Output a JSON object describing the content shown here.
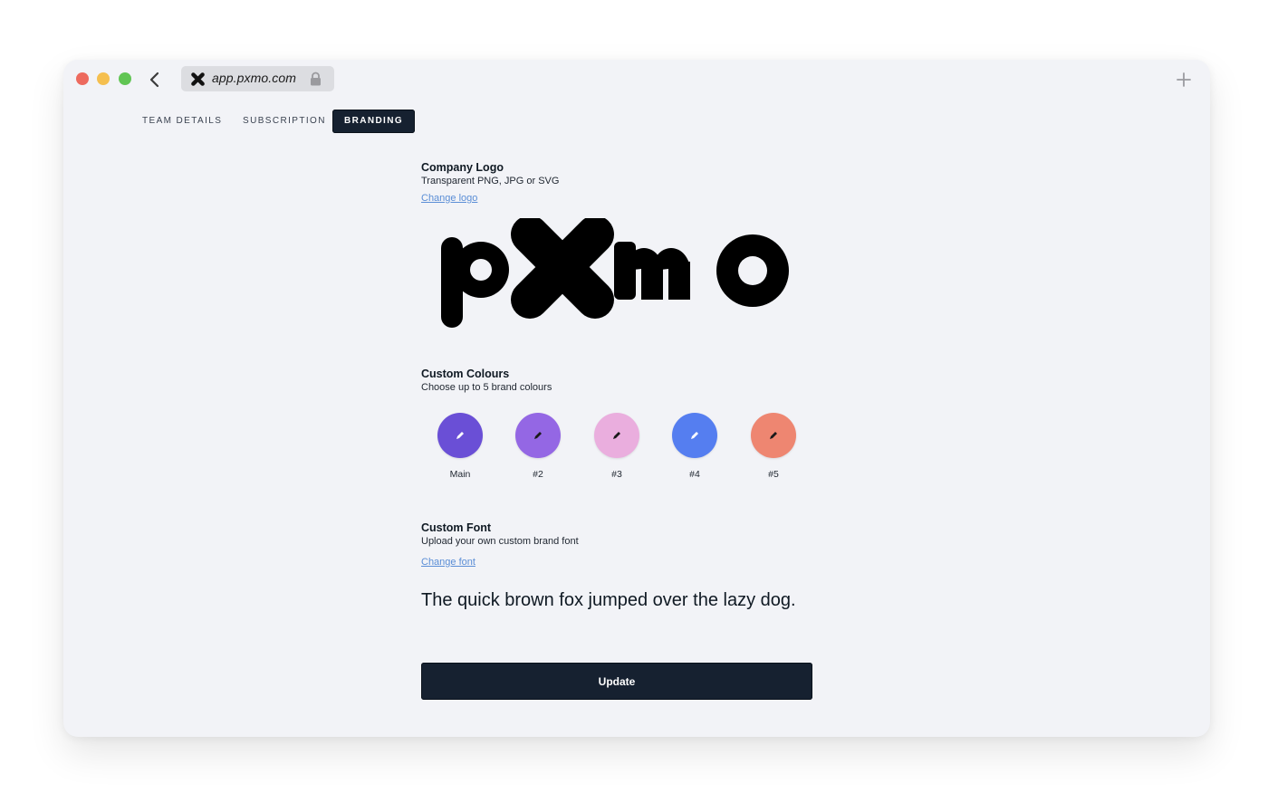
{
  "browser": {
    "url": "app.pxmo.com"
  },
  "tabs": [
    {
      "label": "TEAM DETAILS",
      "active": false
    },
    {
      "label": "SUBSCRIPTION",
      "active": false
    },
    {
      "label": "BRANDING",
      "active": true
    }
  ],
  "logo_section": {
    "title": "Company Logo",
    "subtitle": "Transparent PNG, JPG or SVG",
    "link": "Change logo",
    "logo_icon": "pxmo-wordmark"
  },
  "colours_section": {
    "title": "Custom Colours",
    "subtitle": "Choose up to 5 brand colours",
    "swatches": [
      {
        "label": "Main",
        "color": "#6a4fd6",
        "icon_color": "#ffffff"
      },
      {
        "label": "#2",
        "color": "#9467e4",
        "icon_color": "#1a1a1a"
      },
      {
        "label": "#3",
        "color": "#eaaede",
        "icon_color": "#1a1a1a"
      },
      {
        "label": "#4",
        "color": "#557ef0",
        "icon_color": "#ffffff"
      },
      {
        "label": "#5",
        "color": "#ee8671",
        "icon_color": "#1a1a1a"
      }
    ]
  },
  "font_section": {
    "title": "Custom Font",
    "subtitle": "Upload your own custom brand font",
    "link": "Change font",
    "sample": "The quick brown fox jumped over the lazy dog."
  },
  "update_label": "Update",
  "colors": {
    "window_bg": "#f2f3f7",
    "primary_dark": "#162130",
    "link": "#5b8ed6"
  }
}
